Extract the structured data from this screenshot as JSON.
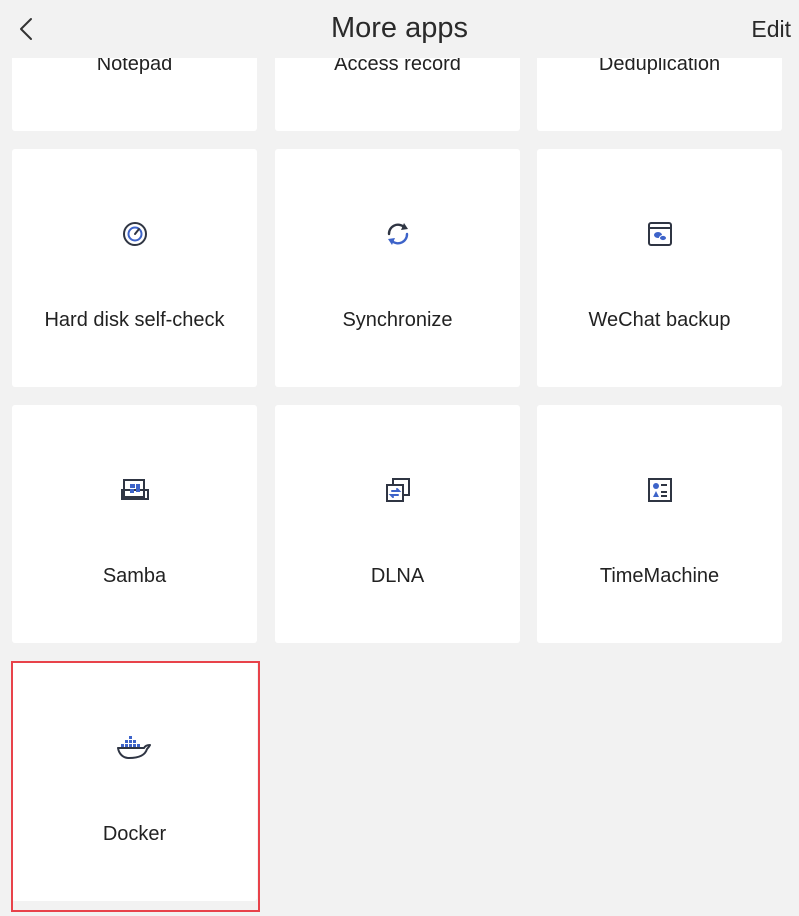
{
  "header": {
    "title": "More apps",
    "edit_label": "Edit"
  },
  "apps_partial": [
    {
      "label": "Notepad"
    },
    {
      "label": "Access record"
    },
    {
      "label": "Deduplication"
    }
  ],
  "apps": [
    {
      "label": "Hard disk self-check",
      "icon": "disk-check-icon"
    },
    {
      "label": "Synchronize",
      "icon": "sync-icon"
    },
    {
      "label": "WeChat backup",
      "icon": "wechat-backup-icon"
    },
    {
      "label": "Samba",
      "icon": "samba-icon"
    },
    {
      "label": "DLNA",
      "icon": "dlna-icon"
    },
    {
      "label": "TimeMachine",
      "icon": "timemachine-icon"
    },
    {
      "label": "Docker",
      "icon": "docker-icon"
    }
  ],
  "colors": {
    "accent": "#3d63c9",
    "icon_dark": "#2f3543",
    "highlight": "#e8424a"
  }
}
